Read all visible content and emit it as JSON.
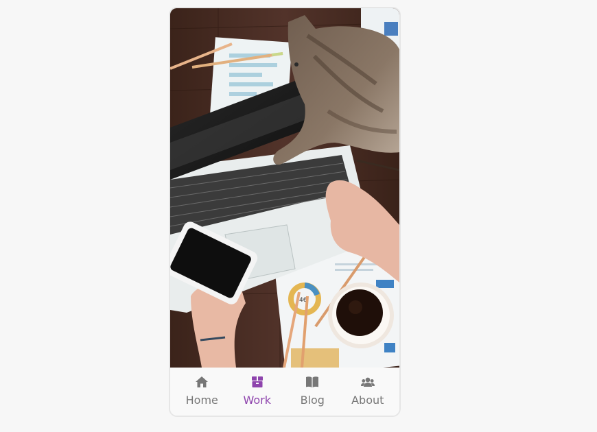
{
  "hero": {
    "image_description_icon": "desk-photo-icon"
  },
  "nav": {
    "active_color": "#8e44ad",
    "inactive_color": "#777777",
    "items": [
      {
        "label": "Home",
        "icon": "home-icon",
        "active": false
      },
      {
        "label": "Work",
        "icon": "box-icon",
        "active": true
      },
      {
        "label": "Blog",
        "icon": "book-icon",
        "active": false
      },
      {
        "label": "About",
        "icon": "users-icon",
        "active": false
      }
    ]
  }
}
